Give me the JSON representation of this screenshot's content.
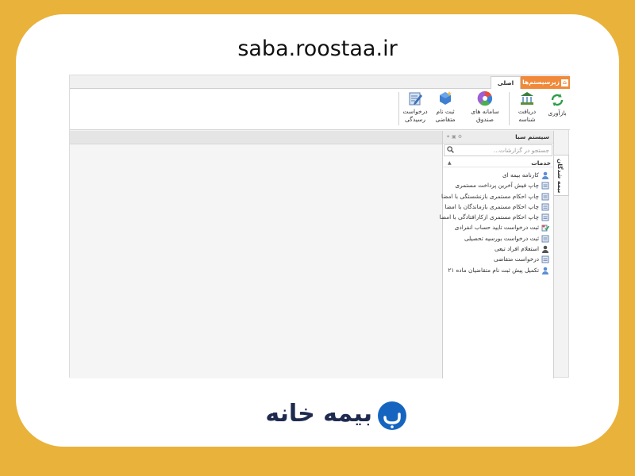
{
  "site_title": "saba.roostaa.ir",
  "menu": {
    "subsystems_label": "زیرسیستم‌ها ▾",
    "main_tab": "اصلی"
  },
  "ribbon": {
    "refresh": "بازآوری",
    "get_id_1": "دریافت",
    "get_id_2": "شناسه",
    "fund_1": "سامانه های",
    "fund_2": "صندوق",
    "register_1": "ثبت نام",
    "register_2": "متقاضی",
    "request_1": "درخواست",
    "request_2": "رسیدگی"
  },
  "panel": {
    "title": "سیستم سبا",
    "search_placeholder": "جستجو در گزارشات...",
    "group": "خدمات",
    "items": [
      "کارنامه بیمه ای",
      "چاپ فیش آخرین پرداخت مستمری",
      "چاپ احکام مستمری بازنشستگی با امضا",
      "چاپ احکام مستمری بازماندگان با امضا",
      "چاپ احکام مستمری ازکارافتادگی با امضا",
      "ثبت درخواست تایید حساب انفرادی",
      "ثبت درخواست بورسیه تحصیلی",
      "استعلام افراد تبعی",
      "درخواست متقاضی",
      "تکمیل پیش ثبت نام متقاضیان ماده ۲۱"
    ],
    "vertical_tab": "بیمه شدگان"
  },
  "brand": {
    "logo_text": "بیمه خانه"
  },
  "colors": {
    "frame": "#e9b23a",
    "menu": "#f08a3a",
    "brand": "#1f2a4f",
    "logo_circle": "#1565c0"
  }
}
